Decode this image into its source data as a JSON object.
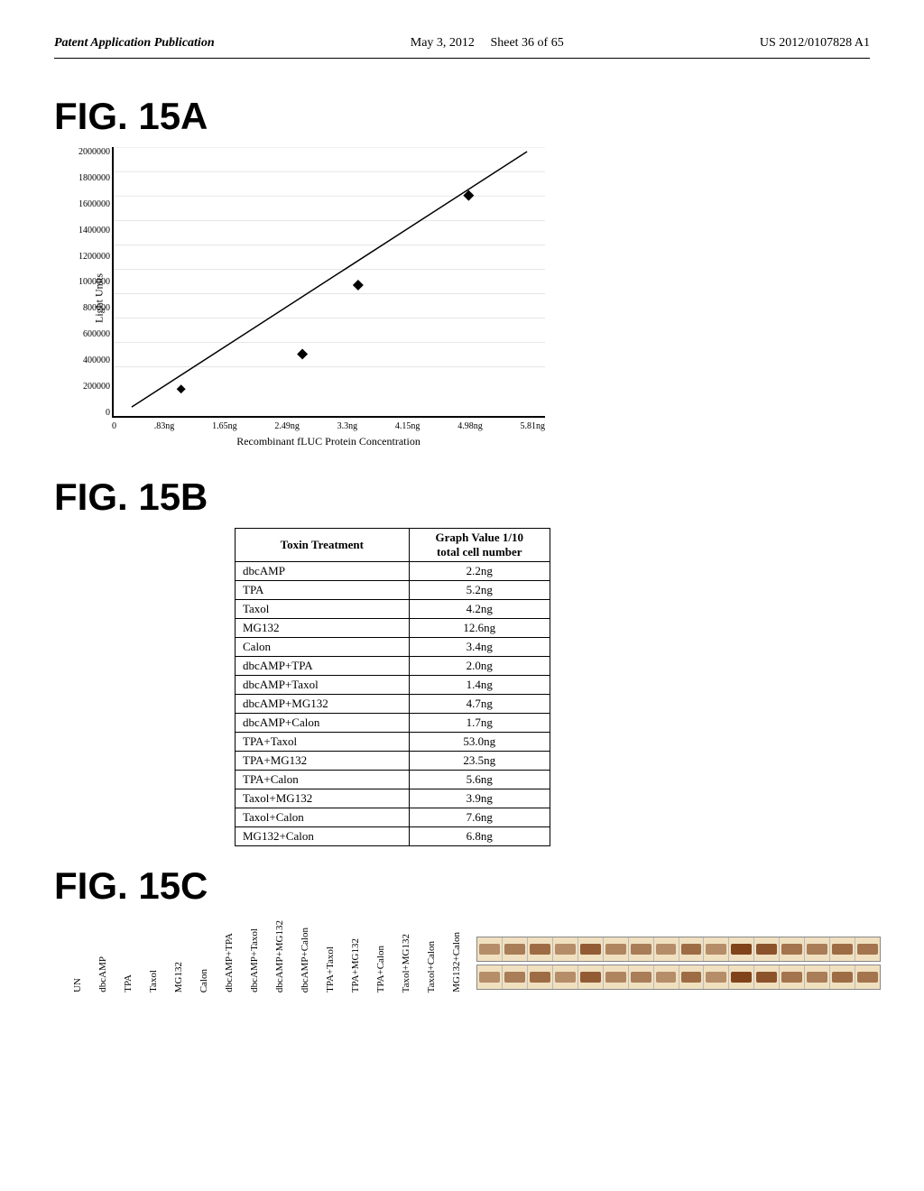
{
  "header": {
    "left_label": "Patent Application Publication",
    "center_date": "May 3, 2012",
    "sheet_info": "Sheet 36 of 65",
    "patent_number": "US 2012/0107828 A1"
  },
  "fig15a": {
    "label": "FIG. 15A",
    "y_axis_label": "Light Units",
    "x_axis_title": "Recombinant fLUC Protein Concentration",
    "y_ticks": [
      "0",
      "200000",
      "400000",
      "600000",
      "800000",
      "1000000",
      "1200000",
      "1400000",
      "1600000",
      "1800000",
      "2000000"
    ],
    "x_ticks": [
      "0",
      ".83ng",
      "1.65ng",
      "2.49ng",
      "3.3ng",
      "4.15ng",
      "4.98ng",
      "5.81ng"
    ]
  },
  "fig15b": {
    "label": "FIG. 15B",
    "col1_header": "Toxin Treatment",
    "col2_header1": "Graph Value 1/10",
    "col2_header2": "total cell number",
    "rows": [
      {
        "treatment": "dbcAMP",
        "value": "2.2ng"
      },
      {
        "treatment": "TPA",
        "value": "5.2ng"
      },
      {
        "treatment": "Taxol",
        "value": "4.2ng"
      },
      {
        "treatment": "MG132",
        "value": "12.6ng"
      },
      {
        "treatment": "Calon",
        "value": "3.4ng"
      },
      {
        "treatment": "dbcAMP+TPA",
        "value": "2.0ng"
      },
      {
        "treatment": "dbcAMP+Taxol",
        "value": "1.4ng"
      },
      {
        "treatment": "dbcAMP+MG132",
        "value": "4.7ng"
      },
      {
        "treatment": "dbcAMP+Calon",
        "value": "1.7ng"
      },
      {
        "treatment": "TPA+Taxol",
        "value": "53.0ng"
      },
      {
        "treatment": "TPA+MG132",
        "value": "23.5ng"
      },
      {
        "treatment": "TPA+Calon",
        "value": "5.6ng"
      },
      {
        "treatment": "Taxol+MG132",
        "value": "3.9ng"
      },
      {
        "treatment": "Taxol+Calon",
        "value": "7.6ng"
      },
      {
        "treatment": "MG132+Calon",
        "value": "6.8ng"
      }
    ]
  },
  "fig15c": {
    "label": "FIG. 15C",
    "lane_labels": [
      "UN",
      "dbcAMP",
      "TPA",
      "Taxol",
      "MG132",
      "Calon",
      "dbcAMP+TPA",
      "dbcAMP+Taxol",
      "dbcAMP+MG132",
      "dbcAMP+Calon",
      "TPA+Taxol",
      "TPA+MG132",
      "TPA+Calon",
      "Taxol+MG132",
      "Taxol+Calon",
      "MG132+Calon"
    ]
  }
}
